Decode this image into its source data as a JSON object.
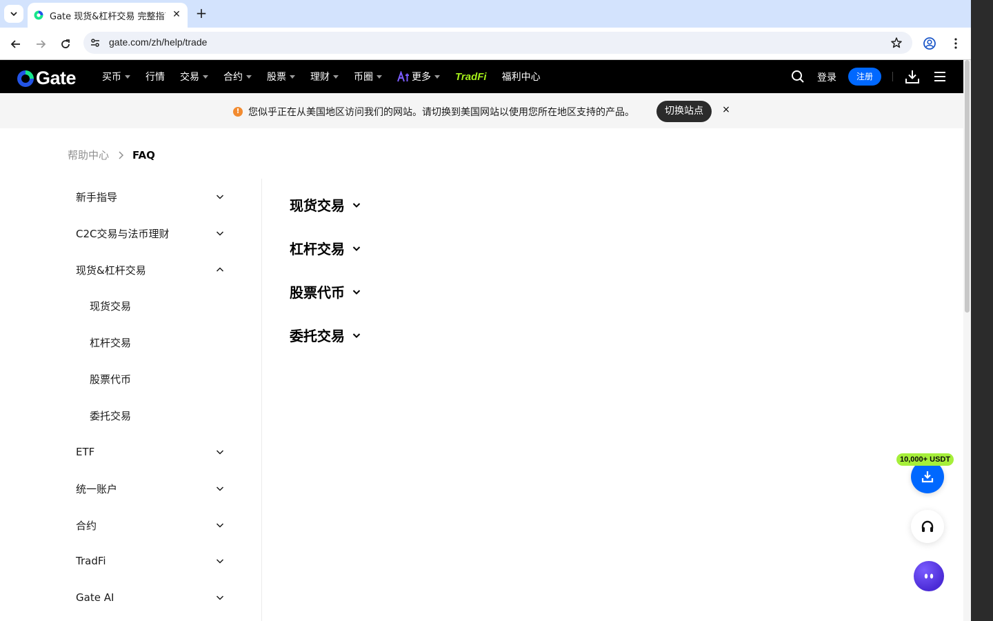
{
  "browser": {
    "tab_title": "Gate 现货&杠杆交易 完整指南",
    "url": "gate.com/zh/help/trade"
  },
  "header": {
    "logo": "Gate",
    "menu": [
      {
        "label": "买币",
        "caret": true
      },
      {
        "label": "行情",
        "caret": false
      },
      {
        "label": "交易",
        "caret": true
      },
      {
        "label": "合约",
        "caret": true
      },
      {
        "label": "股票",
        "caret": true
      },
      {
        "label": "理财",
        "caret": true
      },
      {
        "label": "币圈",
        "caret": true
      },
      {
        "label": "更多",
        "caret": true
      }
    ],
    "tradfi": "TradFi",
    "welfare": "福利中心",
    "login": "登录",
    "register": "注册"
  },
  "banner": {
    "text": "您似乎正在从美国地区访问我们的网站。请切换到美国网站以使用您所在地区支持的产品。",
    "switch_label": "切换站点",
    "close": "×"
  },
  "breadcrumb": {
    "home": "帮助中心",
    "current": "FAQ"
  },
  "sidebar": {
    "items": [
      {
        "label": "新手指导",
        "expanded": false
      },
      {
        "label": "C2C交易与法币理财",
        "expanded": false
      },
      {
        "label": "现货&杠杆交易",
        "expanded": true
      },
      {
        "label": "ETF",
        "expanded": false
      },
      {
        "label": "统一账户",
        "expanded": false
      },
      {
        "label": "合约",
        "expanded": false
      },
      {
        "label": "TradFi",
        "expanded": false
      },
      {
        "label": "Gate AI",
        "expanded": false
      }
    ],
    "subitems": [
      "现货交易",
      "杠杆交易",
      "股票代币",
      "委托交易"
    ]
  },
  "content": {
    "sections": [
      "现货交易",
      "杠杆交易",
      "股票代币",
      "委托交易"
    ]
  },
  "floating": {
    "promo": "10,000+ USDT"
  },
  "colors": {
    "brand_blue": "#0068ff",
    "tradfi_green": "#a4ef1a",
    "promo_green": "#a6ef3a",
    "warning_orange": "#f28b30"
  }
}
